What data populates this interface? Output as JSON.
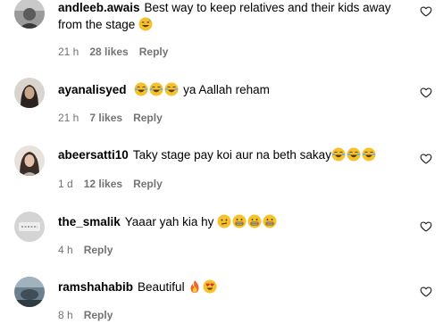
{
  "comments": [
    {
      "username": "andleeb.awais",
      "text_line1": "Best way to keep relatives and their kids away",
      "text_line2": "from the stage",
      "time": "21 h",
      "likes": "28 likes",
      "reply": "Reply",
      "emojis_after_text": [
        "grinning-sweat-emoji"
      ]
    },
    {
      "username": "ayanalisyed",
      "text": "ya Aallah reham",
      "time": "21 h",
      "likes": "7 likes",
      "reply": "Reply",
      "emojis_before_text": [
        "laughing-tears-emoji",
        "laughing-tears-emoji",
        "laughing-tears-emoji"
      ]
    },
    {
      "username": "abeersatti10",
      "text": "Taky stage pay koi aur na beth sakay",
      "time": "1 d",
      "likes": "12 likes",
      "reply": "Reply",
      "emojis_after_text": [
        "laughing-tears-emoji",
        "laughing-tears-emoji",
        "laughing-tears-emoji"
      ]
    },
    {
      "username": "the_smalik",
      "text": "Yaaar yah kia hy",
      "time": "4 h",
      "likes": "",
      "reply": "Reply",
      "emojis_after_text": [
        "confused-emoji",
        "grimacing-emoji",
        "grimacing-emoji",
        "grimacing-emoji"
      ]
    },
    {
      "username": "ramshahabib",
      "text": "Beautiful",
      "time": "8 h",
      "likes": "",
      "reply": "Reply",
      "emojis_after_text": [
        "fire-emoji",
        "heart-eyes-emoji"
      ]
    }
  ],
  "colors": {
    "text": "#000000",
    "meta": "#737373",
    "emoji_yellow": "#f5c22b",
    "heart_stroke": "#262626"
  },
  "icons": {
    "like": "heart-outline-icon"
  }
}
